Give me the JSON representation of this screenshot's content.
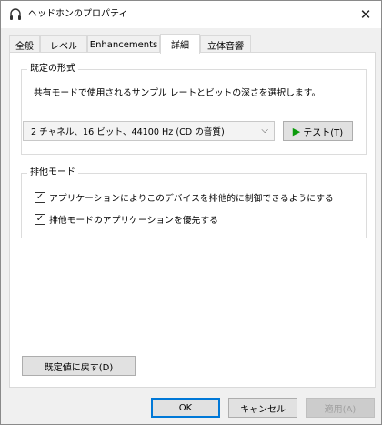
{
  "window": {
    "title": "ヘッドホンのプロパティ",
    "close_glyph": "✕"
  },
  "tabs": [
    {
      "label": "全般",
      "active": false
    },
    {
      "label": "レベル",
      "active": false
    },
    {
      "label": "Enhancements",
      "active": false
    },
    {
      "label": "詳細",
      "active": true
    },
    {
      "label": "立体音響",
      "active": false
    }
  ],
  "default_format": {
    "group_title": "既定の形式",
    "description": "共有モードで使用されるサンプル レートとビットの深さを選択します。",
    "selected_format": "2 チャネル、16 ビット、44100 Hz (CD の音質)",
    "test_button": "テスト(T)"
  },
  "exclusive_mode": {
    "group_title": "排他モード",
    "options": [
      {
        "label": "アプリケーションによりこのデバイスを排他的に制御できるようにする",
        "checked": true
      },
      {
        "label": "排他モードのアプリケーションを優先する",
        "checked": true
      }
    ]
  },
  "restore_defaults_button": "既定値に戻す(D)",
  "footer": {
    "ok": "OK",
    "cancel": "キャンセル",
    "apply": "適用(A)"
  },
  "icons": {
    "title": "headphones-icon",
    "play": "play-icon",
    "dropdown": "chevron-down-icon",
    "check": "checkmark-icon"
  }
}
